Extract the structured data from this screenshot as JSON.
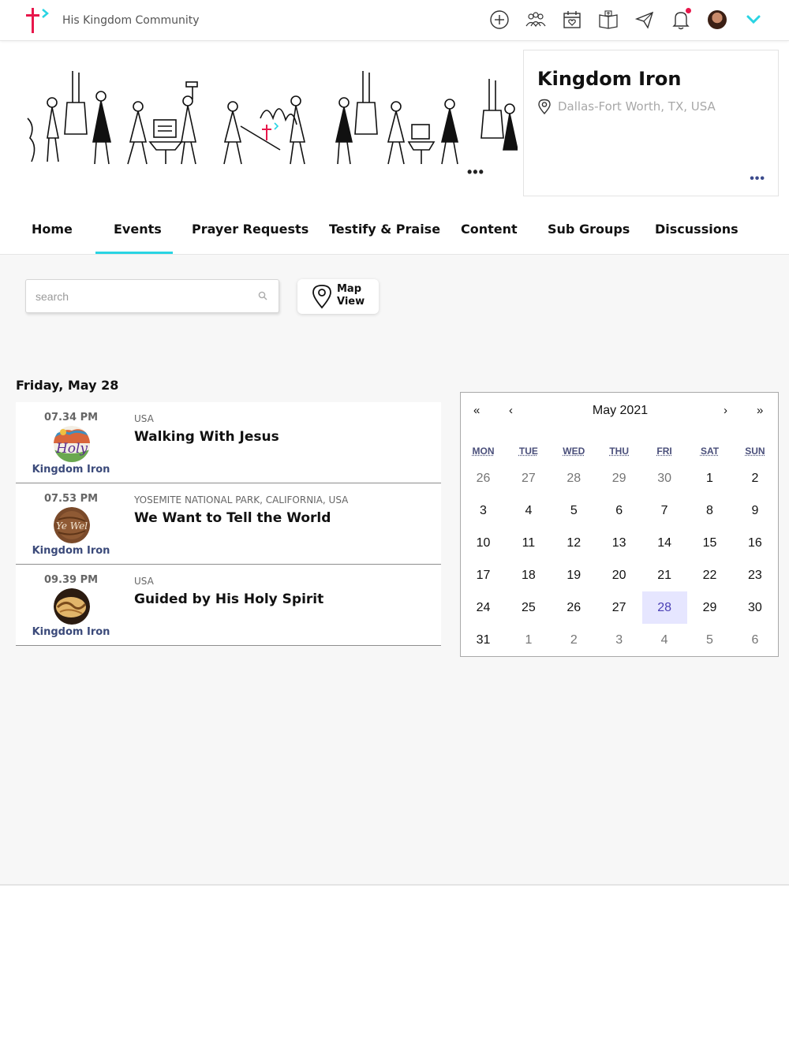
{
  "header": {
    "brand": "His Kingdom Community",
    "icons": [
      "add-circle-icon",
      "groups-icon",
      "calendar-heart-icon",
      "bible-icon",
      "send-icon",
      "bell-icon",
      "avatar",
      "chevron-down-icon"
    ],
    "notification_dot_color": "#e8174b",
    "accent_color": "#29d4e3"
  },
  "group": {
    "title": "Kingdom Iron",
    "location": "Dallas-Fort Worth, TX, USA"
  },
  "tabs": [
    {
      "label": "Home"
    },
    {
      "label": "Events"
    },
    {
      "label": "Prayer Requests"
    },
    {
      "label": "Testify & Praise"
    },
    {
      "label": "Content"
    },
    {
      "label": "Sub Groups"
    },
    {
      "label": "Discussions"
    }
  ],
  "active_tab": "Events",
  "search": {
    "placeholder": "search"
  },
  "map_view": {
    "label_line1": "Map",
    "label_line2": "View"
  },
  "date_heading": "Friday, May 28",
  "events": [
    {
      "time": "07.34 PM",
      "group": "Kingdom Iron",
      "location": "USA",
      "title": "Walking With Jesus",
      "avatar_text": "Holy"
    },
    {
      "time": "07.53 PM",
      "group": "Kingdom Iron",
      "location": "YOSEMITE NATIONAL PARK, CALIFORNIA, USA",
      "title": "We Want to Tell the World",
      "avatar_text": "Ye Wel"
    },
    {
      "time": "09.39 PM",
      "group": "Kingdom Iron",
      "location": "USA",
      "title": "Guided by His Holy Spirit",
      "avatar_text": ""
    }
  ],
  "calendar": {
    "month_label": "May 2021",
    "nav": {
      "first": "«",
      "prev": "‹",
      "next": "›",
      "last": "»"
    },
    "weekdays": [
      "MON",
      "TUE",
      "WED",
      "THU",
      "FRI",
      "SAT",
      "SUN"
    ],
    "weeks": [
      [
        "26",
        "27",
        "28",
        "29",
        "30",
        "1",
        "2"
      ],
      [
        "3",
        "4",
        "5",
        "6",
        "7",
        "8",
        "9"
      ],
      [
        "10",
        "11",
        "12",
        "13",
        "14",
        "15",
        "16"
      ],
      [
        "17",
        "18",
        "19",
        "20",
        "21",
        "22",
        "23"
      ],
      [
        "24",
        "25",
        "26",
        "27",
        "28",
        "29",
        "30"
      ],
      [
        "31",
        "1",
        "2",
        "3",
        "4",
        "5",
        "6"
      ]
    ],
    "selected_day": "28",
    "selected_color": "#e6e6ff"
  }
}
